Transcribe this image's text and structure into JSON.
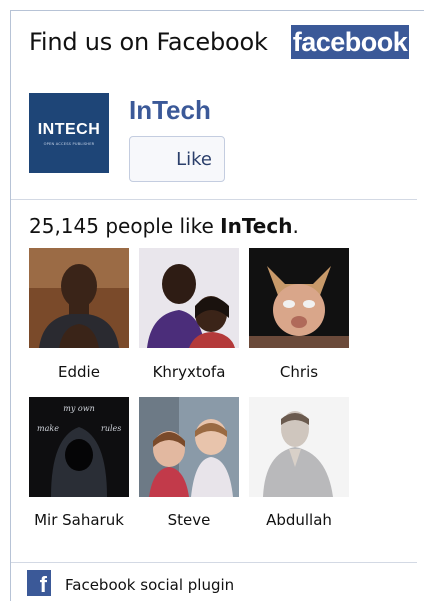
{
  "header": {
    "title": "Find us on Facebook",
    "brand_logo_text": "facebook"
  },
  "page": {
    "logo_text": "INTECH",
    "logo_subtext": "OPEN ACCESS PUBLISHER",
    "name": "InTech",
    "like_button_label": "Like"
  },
  "likes": {
    "count": "25,145",
    "text": " people like ",
    "page_name": "InTech",
    "end": "."
  },
  "fans": [
    {
      "name": "Eddie"
    },
    {
      "name": "Khryxtofa"
    },
    {
      "name": "Chris"
    },
    {
      "name": "Mir Saharuk"
    },
    {
      "name": "Steve"
    },
    {
      "name": "Abdullah"
    }
  ],
  "fan_photo_texts": {
    "mir_saharuk": [
      "my own",
      "make",
      "rules"
    ]
  },
  "footer": {
    "icon": "facebook-f-icon",
    "text": "Facebook social plugin"
  },
  "colors": {
    "facebook_blue": "#3b5998",
    "page_logo_bg": "#1e4577"
  }
}
